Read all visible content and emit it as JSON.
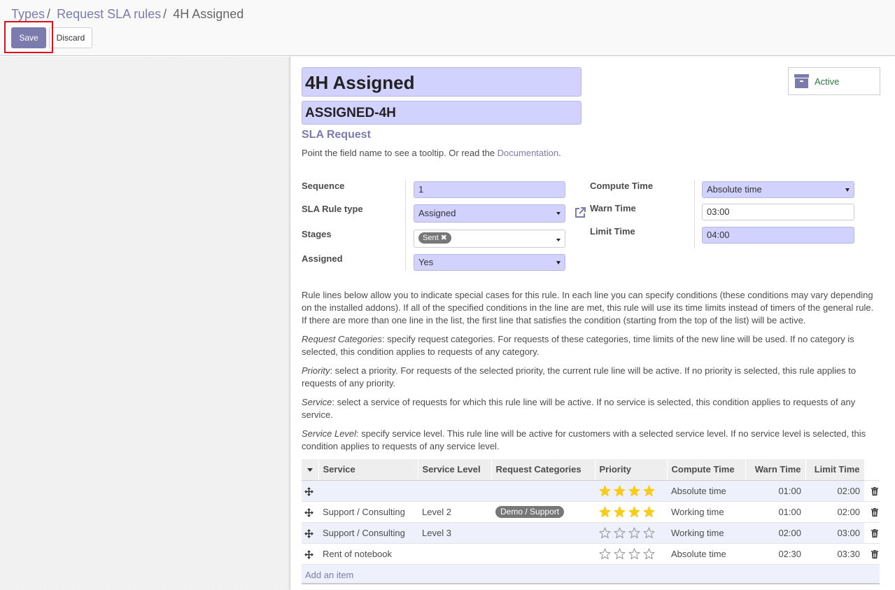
{
  "breadcrumb": {
    "items": [
      "Types",
      "Request SLA rules"
    ],
    "separator": "/",
    "current": "4H Assigned"
  },
  "toolbar": {
    "save_label": "Save",
    "discard_label": "Discard"
  },
  "record": {
    "name": "4H Assigned",
    "code": "ASSIGNED-4H",
    "active_label": "Active",
    "section_title": "SLA Request",
    "hint_text": "Point the field name to see a tooltip. Or read the ",
    "hint_link": "Documentation",
    "hint_end": "."
  },
  "fields": {
    "sequence": {
      "label": "Sequence",
      "value": "1"
    },
    "rule_type": {
      "label": "SLA Rule type",
      "value": "Assigned"
    },
    "stages": {
      "label": "Stages",
      "tag": "Sent"
    },
    "assigned": {
      "label": "Assigned",
      "value": "Yes"
    },
    "compute_time": {
      "label": "Compute Time",
      "value": "Absolute time"
    },
    "warn_time": {
      "label": "Warn Time",
      "value": "03:00"
    },
    "limit_time": {
      "label": "Limit Time",
      "value": "04:00"
    }
  },
  "help": {
    "intro": "Rule lines below allow you to indicate special cases for this rule. In each line you can specify conditions (these conditions may vary depending on the installed addons). If all of the specified conditions in the line are met, this rule will use its time limits instead of timers of the general rule. If there are more than one line in the list, the first line that satisfies the condition (starting from the top of the list) will be active.",
    "categories_term": "Request Categories",
    "categories_text": ": specify request categories. For requests of these categories, time limits of the new line will be used. If no category is selected, this condition applies to requests of any category.",
    "priority_term": "Priority",
    "priority_text": ": select a priority. For requests of the selected priority, the current rule line will be active. If no priority is selected, this rule applies to requests of any priority.",
    "service_term": "Service",
    "service_text": ": select a service of requests for which this rule line will be active. If no service is selected, this condition applies to requests of any service.",
    "level_term": "Service Level",
    "level_text": ": specify service level. This rule line will be active for customers with a selected service level. If no service level is selected, this condition applies to requests of any service level."
  },
  "table": {
    "columns": [
      "Service",
      "Service Level",
      "Request Categories",
      "Priority",
      "Compute Time",
      "Warn Time",
      "Limit Time"
    ],
    "rows": [
      {
        "service": "",
        "level": "",
        "category": "",
        "priority": 4,
        "compute": "Absolute time",
        "warn": "01:00",
        "limit": "02:00"
      },
      {
        "service": "Support / Consulting",
        "level": "Level 2",
        "category": "Demo / Support",
        "priority": 4,
        "compute": "Working time",
        "warn": "01:00",
        "limit": "02:00"
      },
      {
        "service": "Support / Consulting",
        "level": "Level 3",
        "category": "",
        "priority": 0,
        "compute": "Working time",
        "warn": "02:00",
        "limit": "03:00"
      },
      {
        "service": "Rent of notebook",
        "level": "",
        "category": "",
        "priority": 0,
        "compute": "Absolute time",
        "warn": "02:30",
        "limit": "03:30"
      }
    ],
    "add_label": "Add an item"
  },
  "colors": {
    "accent": "#7c7bad",
    "field_bg": "#d2d2ff",
    "star_filled": "#f7cc1c",
    "active_text": "#2d7a3f",
    "highlight": "#e0101b"
  },
  "icons": {
    "row_handle": "move-icon",
    "row_delete": "trash-icon",
    "archive": "archive-icon",
    "external": "external-link-icon"
  }
}
